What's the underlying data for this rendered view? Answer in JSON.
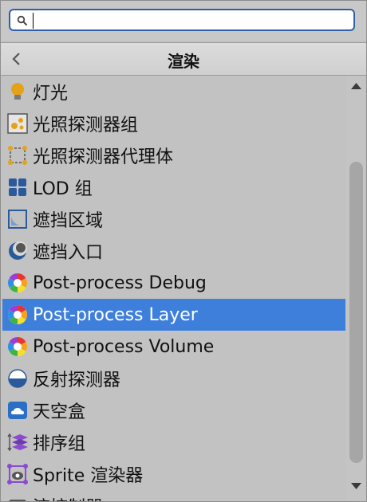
{
  "search": {
    "value": "",
    "placeholder": ""
  },
  "header": {
    "title": "渲染"
  },
  "items": [
    {
      "label": "灯光",
      "icon": "light-bulb-icon"
    },
    {
      "label": "光照探测器组",
      "icon": "light-probe-group-icon"
    },
    {
      "label": "光照探测器代理体",
      "icon": "light-probe-proxy-volume-icon"
    },
    {
      "label": "LOD 组",
      "icon": "lod-group-icon"
    },
    {
      "label": "遮挡区域",
      "icon": "occlusion-area-icon"
    },
    {
      "label": "遮挡入口",
      "icon": "occlusion-portal-icon"
    },
    {
      "label": "Post-process Debug",
      "icon": "post-process-icon"
    },
    {
      "label": "Post-process Layer",
      "icon": "post-process-icon",
      "selected": true
    },
    {
      "label": "Post-process Volume",
      "icon": "post-process-icon"
    },
    {
      "label": "反射探测器",
      "icon": "reflection-probe-icon"
    },
    {
      "label": "天空盒",
      "icon": "skybox-icon"
    },
    {
      "label": "排序组",
      "icon": "sorting-group-icon"
    },
    {
      "label": "Sprite 渲染器",
      "icon": "sprite-renderer-icon"
    },
    {
      "label": "流控制器",
      "icon": "streaming-controller-icon"
    }
  ],
  "colors": {
    "selection": "#3f7fdc",
    "focus_border": "#2e5fa8"
  }
}
